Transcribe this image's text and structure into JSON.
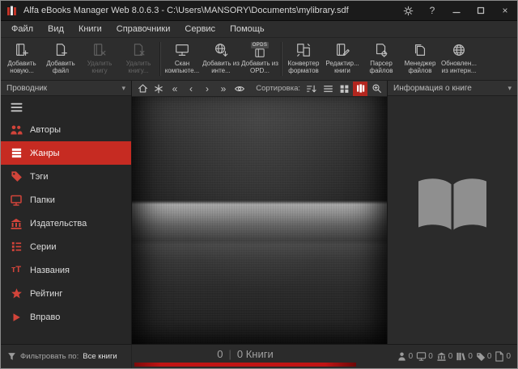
{
  "window": {
    "title": "Alfa eBooks Manager Web 8.0.6.3 - C:\\Users\\MANSORY\\Documents\\mylibrary.sdf",
    "controls": {
      "help": "?",
      "close": "×"
    }
  },
  "menubar": {
    "items": [
      {
        "label": "Файл"
      },
      {
        "label": "Вид"
      },
      {
        "label": "Книги"
      },
      {
        "label": "Справочники"
      },
      {
        "label": "Сервис"
      },
      {
        "label": "Помощь"
      }
    ]
  },
  "toolbar": {
    "buttons": [
      {
        "label": "Добавить новую...",
        "enabled": true
      },
      {
        "label": "Добавить файл",
        "enabled": true
      },
      {
        "label": "Удалить книгу",
        "enabled": false
      },
      {
        "label": "Удалить книгу...",
        "enabled": false
      },
      {
        "label": "Скан компьюте...",
        "enabled": true
      },
      {
        "label": "Добавить из инте...",
        "enabled": true
      },
      {
        "label": "Добавить из OPD...",
        "enabled": true,
        "badge": "OPDS"
      },
      {
        "label": "Конвертер форматов",
        "enabled": true
      },
      {
        "label": "Редактир... книги",
        "enabled": true
      },
      {
        "label": "Парсер файлов",
        "enabled": true
      },
      {
        "label": "Менеджер файлов",
        "enabled": true
      },
      {
        "label": "Обновлен... из интерн...",
        "enabled": true
      }
    ]
  },
  "sidebar": {
    "header": "Проводник",
    "caret": "▾",
    "items": [
      {
        "label": "Авторы"
      },
      {
        "label": "Жанры",
        "selected": true
      },
      {
        "label": "Тэги"
      },
      {
        "label": "Папки"
      },
      {
        "label": "Издательства"
      },
      {
        "label": "Серии"
      },
      {
        "label": "Названия"
      },
      {
        "label": "Рейтинг"
      },
      {
        "label": "Вправо"
      }
    ],
    "icons": {
      "titles_glyph": "тТ"
    }
  },
  "carousel": {
    "sort_label": "Сортировка:",
    "nav": {
      "first": "«",
      "prev": "‹",
      "next": "›",
      "last": "»"
    }
  },
  "info_panel": {
    "header": "Информация о книге",
    "caret": "▾"
  },
  "statusbar": {
    "filter_label": "Фильтровать по:",
    "filter_value": "Все книги",
    "center": {
      "selected": "0",
      "divider": "|",
      "total": "0 Книги"
    },
    "counters": [
      {
        "value": "0"
      },
      {
        "value": "0"
      },
      {
        "value": "0"
      },
      {
        "value": "0"
      },
      {
        "value": "0"
      },
      {
        "value": "0"
      }
    ]
  },
  "colors": {
    "accent_red": "#c62b22",
    "progress_red": "#c01414",
    "sidebar_icon_red": "#d2443a"
  }
}
